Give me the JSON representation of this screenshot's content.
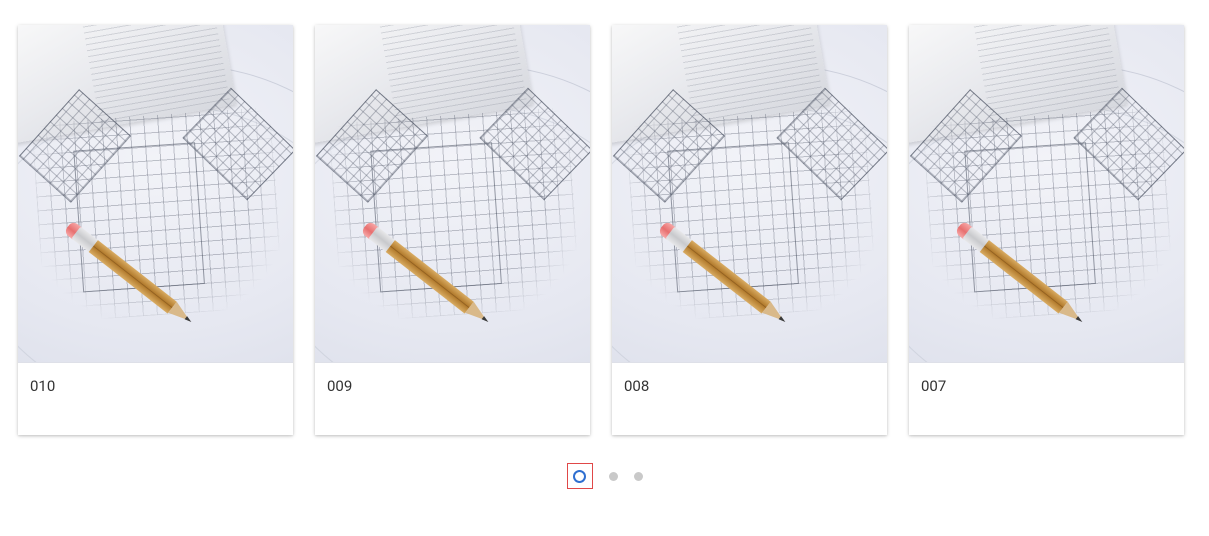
{
  "cards": [
    {
      "label": "010"
    },
    {
      "label": "009"
    },
    {
      "label": "008"
    },
    {
      "label": "007"
    }
  ],
  "pagination": {
    "active_index": 0,
    "count": 3
  }
}
